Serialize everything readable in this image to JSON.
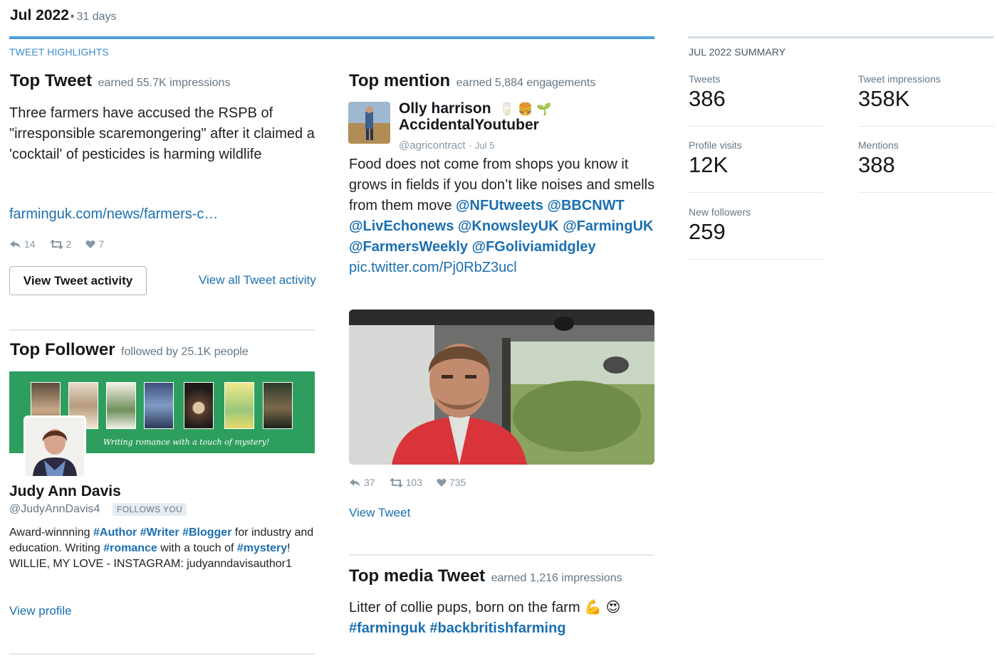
{
  "header": {
    "period": "Jul 2022",
    "separator": "•",
    "days": "31 days"
  },
  "highlights_caption": "TWEET HIGHLIGHTS",
  "top_tweet": {
    "title": "Top Tweet",
    "subtitle": "earned 55.7K impressions",
    "text": "Three farmers have accused the RSPB of \"irresponsible scaremongering\" after it claimed a 'cocktail' of pesticides is harming wildlife",
    "link": "farminguk.com/news/farmers-c…",
    "replies": "14",
    "retweets": "2",
    "likes": "7",
    "view_activity_button": "View Tweet activity",
    "view_all_link": "View all Tweet activity"
  },
  "top_follower": {
    "title": "Top Follower",
    "subtitle": "followed by 25.1K people",
    "banner_caption": "Writing romance with a touch of mystery!",
    "name": "Judy Ann Davis",
    "handle": "@JudyAnnDavis4",
    "follows_badge": "FOLLOWS YOU",
    "bio": {
      "p1": "Award-winnning ",
      "tag_author": "#Author",
      "tag_writer": "#Writer",
      "tag_blogger": "#Blogger",
      "p2": " for industry and education. Writing ",
      "tag_romance": "#romance",
      "p3": " with a touch of ",
      "tag_mystery": "#mystery",
      "p4": "! WILLIE, MY LOVE - INSTAGRAM: judyanndavisauthor1"
    },
    "view_profile": "View profile"
  },
  "top_mention": {
    "title": "Top mention",
    "subtitle": "earned 5,884 engagements",
    "name_line1": "Olly harrison",
    "name_emojis": "🥛 🍔 🌱",
    "name_line2": "AccidentalYoutuber",
    "handle": "@agricontract",
    "date": "Jul 5",
    "text": "Food does not come from shops you know it grows in fields if you don’t like noises and smells from them move ",
    "mentions": [
      "@NFUtweets",
      "@BBCNWT",
      "@LivEchonews",
      "@KnowsleyUK",
      "@FarmingUK",
      "@FarmersWeekly",
      "@FGoliviamidgley"
    ],
    "pic_link": "pic.twitter.com/Pj0RbZ3ucl",
    "replies": "37",
    "retweets": "103",
    "likes": "735",
    "view_tweet": "View Tweet"
  },
  "top_media": {
    "title": "Top media Tweet",
    "subtitle": "earned 1,216 impressions",
    "text": "Litter of collie pups, born on the farm ",
    "emojis": "💪 😍",
    "tags": [
      "#farminguk",
      "#backbritishfarming"
    ]
  },
  "summary": {
    "caption": "JUL 2022 SUMMARY",
    "tweets_label": "Tweets",
    "tweets_value": "386",
    "impressions_label": "Tweet impressions",
    "impressions_value": "358K",
    "profile_visits_label": "Profile visits",
    "profile_visits_value": "12K",
    "mentions_label": "Mentions",
    "mentions_value": "388",
    "new_followers_label": "New followers",
    "new_followers_value": "259"
  },
  "colors": {
    "accent": "#4f9fd6",
    "link": "#1b6fb0",
    "banner_green": "#2e9e5e"
  }
}
